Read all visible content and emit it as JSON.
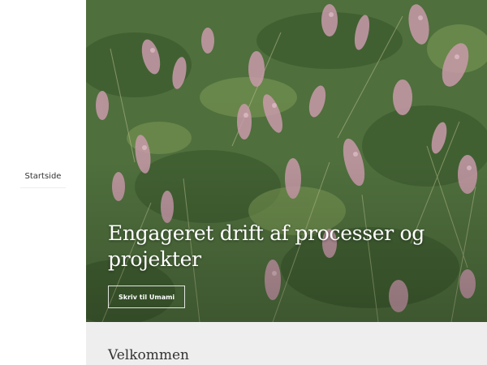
{
  "sidebar": {
    "nav_items": [
      {
        "label": "Startside"
      }
    ]
  },
  "hero": {
    "background": "heather-field-photo",
    "title": "Engageret drift af processer og projekter",
    "cta_label": "Skriv til Umami"
  },
  "welcome": {
    "title": "Velkommen"
  },
  "colors": {
    "text": "#333333",
    "section_bg": "#eeeeee",
    "hero_text": "#ffffff"
  }
}
